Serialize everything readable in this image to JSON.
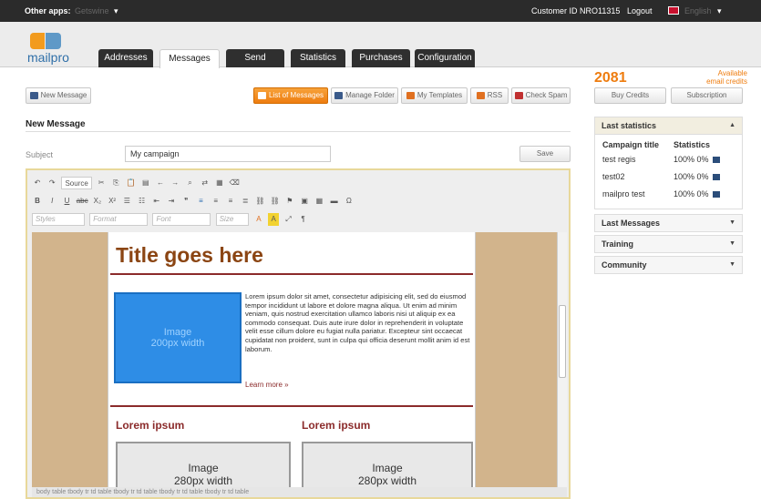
{
  "topbar": {
    "other_apps_label": "Other apps:",
    "other_apps_value": "Getswine",
    "customer_id": "Customer ID NRO11315",
    "logout": "Logout",
    "language": "English"
  },
  "logo": {
    "text": "mailpro"
  },
  "tabs": [
    {
      "label": "Addresses",
      "active": false
    },
    {
      "label": "Messages",
      "active": true
    },
    {
      "label": "Send",
      "active": false
    },
    {
      "label": "Statistics",
      "active": false
    },
    {
      "label": "Purchases",
      "active": false
    },
    {
      "label": "Configuration",
      "active": false
    }
  ],
  "toolbar": {
    "new_message": "New Message",
    "list_of_messages": "List of Messages",
    "manage_folder": "Manage Folder",
    "my_templates": "My Templates",
    "rss": "RSS",
    "check_spam": "Check Spam"
  },
  "credits": {
    "count": "2081",
    "available_l1": "Available",
    "available_l2": "email credits",
    "buy": "Buy Credits",
    "subscription": "Subscription"
  },
  "page": {
    "title": "New Message",
    "subject_label": "Subject",
    "subject_value": "My campaign",
    "save": "Save"
  },
  "editor": {
    "source": "Source",
    "styles": "Styles",
    "format": "Format",
    "font": "Font",
    "size": "Size",
    "doc_title": "Title goes here",
    "image_main_l1": "Image",
    "image_main_l2": "200px width",
    "lorem_text": "Lorem ipsum dolor sit amet, consectetur adipisicing elit, sed do eiusmod tempor incididunt ut labore et dolore magna aliqua. Ut enim ad minim veniam, quis nostrud exercitation ullamco laboris nisi ut aliquip ex ea commodo consequat. Duis aute irure dolor in reprehenderit in voluptate velit esse cillum dolore eu fugiat nulla pariatur. Excepteur sint occaecat cupidatat non proident, sunt in culpa qui officia deserunt mollit anim id est laborum.",
    "learn_more": "Learn more »",
    "col1_heading": "Lorem ipsum",
    "col2_heading": "Lorem ipsum",
    "col1_image_l1": "Image",
    "col1_image_l2": "280px width",
    "col2_image_l1": "Image",
    "col2_image_l2": "280px width",
    "path": "body  table  tbody  tr  td  table  tbody  tr  td  table  tbody  tr  td  table  tbody  tr  td  table"
  },
  "sidebar": {
    "last_statistics": "Last statistics",
    "col_campaign": "Campaign title",
    "col_statistics": "Statistics",
    "rows": [
      {
        "title": "test regis",
        "stat": "100% 0%"
      },
      {
        "title": "test02",
        "stat": "100% 0%"
      },
      {
        "title": "mailpro test",
        "stat": "100% 0%"
      }
    ],
    "last_messages": "Last Messages",
    "training": "Training",
    "community": "Community"
  },
  "colors": {
    "accent": "#ee7d10",
    "dark": "#2b2b2b",
    "brand_blue": "#2f6fa8",
    "image_blue": "#2e8de6"
  }
}
